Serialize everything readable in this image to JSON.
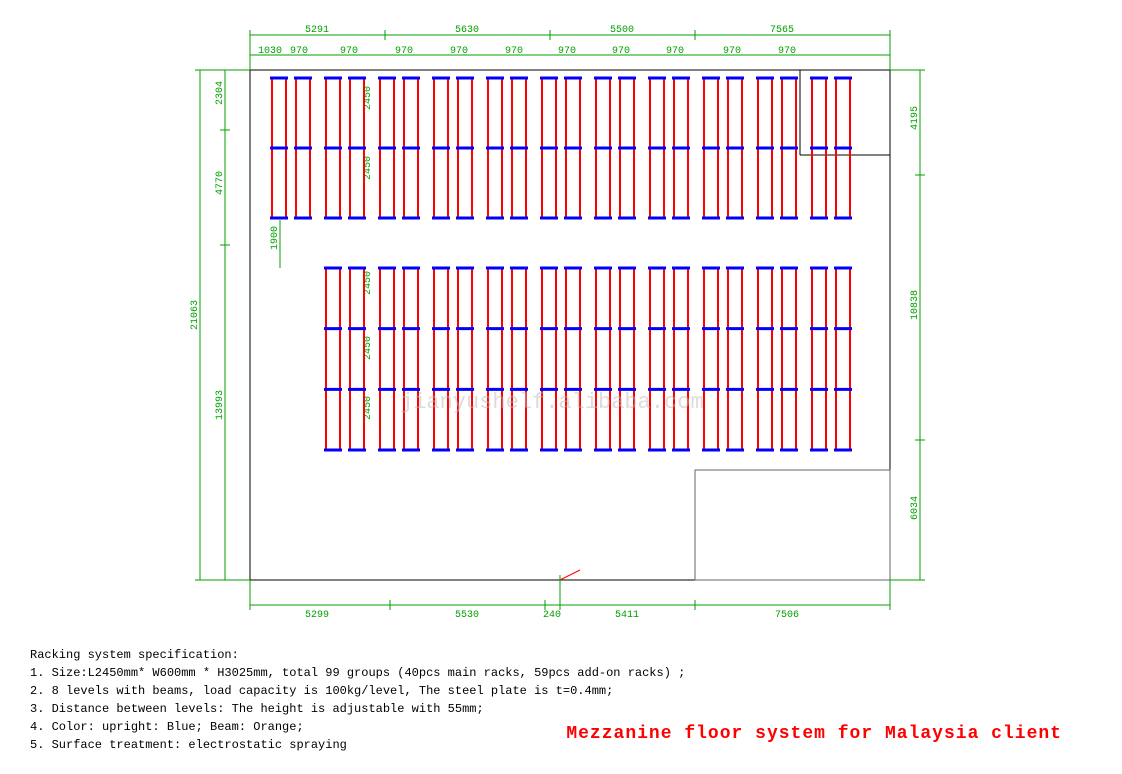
{
  "title": "Mezzanine floor system for Malaysia client",
  "watermark": "jianyushelf.alibaba.com",
  "dimensions": {
    "top_major": [
      "5291",
      "5630",
      "5500",
      "7565"
    ],
    "top_minor": [
      "1030",
      "970",
      "970",
      "970",
      "970",
      "970",
      "970",
      "970",
      "970",
      "970",
      "970"
    ],
    "bottom": [
      "5299",
      "5530",
      "240",
      "5411",
      "7506"
    ],
    "left_full": "21063",
    "left_segments": [
      "2304",
      "4770",
      "13993"
    ],
    "left_gap": "1900",
    "right_segments": [
      "4195",
      "10838",
      "6034"
    ],
    "internal_heights": [
      "2450",
      "2450",
      "2450",
      "2450",
      "2450"
    ]
  },
  "spec": {
    "heading": "Racking system specification:",
    "lines": [
      "1. Size:L2450mm* W600mm * H3025mm, total 99 groups (40pcs main racks, 59pcs add-on racks) ;",
      "2. 8 levels with beams, load capacity is 100kg/level, The steel plate is t=0.4mm;",
      "3. Distance between levels: The height is adjustable with 55mm;",
      "4. Color: upright: Blue; Beam: Orange;",
      "5. Surface treatment: electrostatic spraying"
    ]
  }
}
